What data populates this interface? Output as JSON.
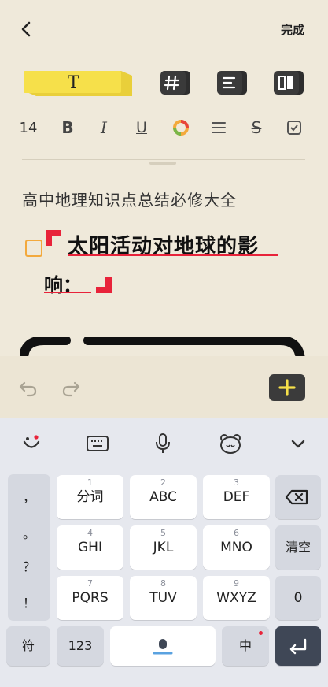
{
  "header": {
    "done_label": "完成"
  },
  "toolbar": {
    "font_size": "14",
    "bold": "B",
    "italic": "I",
    "underline": "U",
    "strike": "S",
    "text_icon": "T"
  },
  "document": {
    "title": "高中地理知识点总结必修大全",
    "heading_line1": "太阳活动对地球的影",
    "heading_line2": "响："
  },
  "colors": {
    "accent_yellow": "#f6e04a",
    "mark_red": "#e8233a",
    "checkbox_orange": "#f3a93c",
    "dark_button": "#3b3b3b"
  },
  "keyboard": {
    "punctuation": [
      "，",
      "。",
      "？",
      "！"
    ],
    "keys": [
      {
        "num": "1",
        "label": "分词"
      },
      {
        "num": "2",
        "label": "ABC"
      },
      {
        "num": "3",
        "label": "DEF"
      },
      {
        "num": "4",
        "label": "GHI"
      },
      {
        "num": "5",
        "label": "JKL"
      },
      {
        "num": "6",
        "label": "MNO"
      },
      {
        "num": "7",
        "label": "PQRS"
      },
      {
        "num": "8",
        "label": "TUV"
      },
      {
        "num": "9",
        "label": "WXYZ"
      }
    ],
    "clear_label": "清空",
    "zero_label": "0",
    "symbol_label": "符",
    "num_label": "123",
    "lang_label": "中"
  }
}
